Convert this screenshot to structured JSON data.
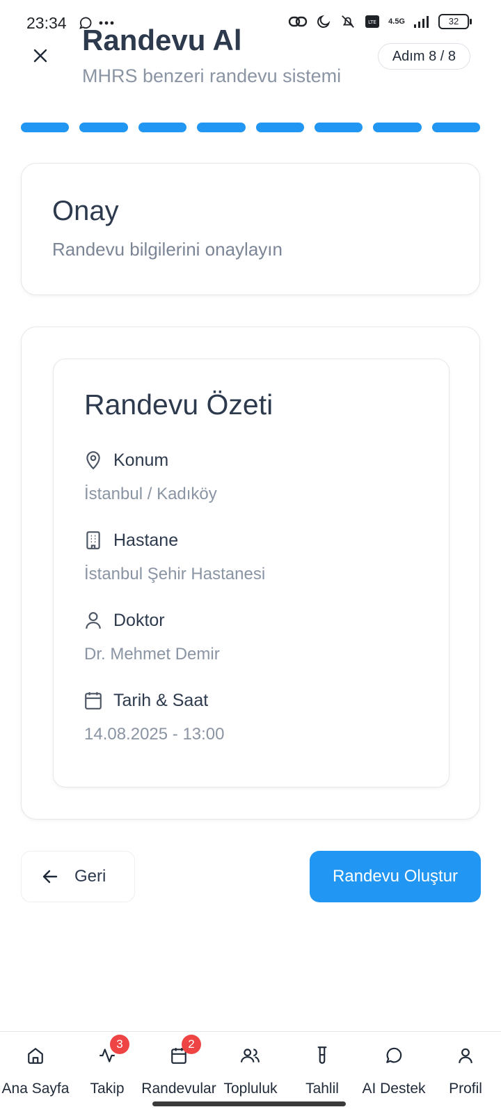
{
  "status_bar": {
    "time": "23:34",
    "network": "4.5G",
    "battery": "32"
  },
  "header": {
    "title": "Randevu Al",
    "subtitle": "MHRS benzeri randevu sistemi",
    "step_badge": "Adım 8 / 8"
  },
  "progress": {
    "total_steps": 8,
    "completed_steps": 8,
    "color": "#2196f3"
  },
  "step_card": {
    "title": "Onay",
    "subtitle": "Randevu bilgilerini onaylayın"
  },
  "summary": {
    "title": "Randevu Özeti",
    "items": [
      {
        "icon": "map-pin-icon",
        "label": "Konum",
        "value": "İstanbul / Kadıköy"
      },
      {
        "icon": "building-icon",
        "label": "Hastane",
        "value": "İstanbul Şehir Hastanesi"
      },
      {
        "icon": "user-icon",
        "label": "Doktor",
        "value": "Dr. Mehmet Demir"
      },
      {
        "icon": "calendar-icon",
        "label": "Tarih & Saat",
        "value": "14.08.2025 - 13:00"
      }
    ]
  },
  "actions": {
    "back_label": "Geri",
    "submit_label": "Randevu Oluştur"
  },
  "bottom_nav": {
    "items": [
      {
        "label": "Ana Sayfa",
        "icon": "home-icon"
      },
      {
        "label": "Takip",
        "icon": "activity-icon",
        "badge": "3"
      },
      {
        "label": "Randevular",
        "icon": "calendar-icon",
        "badge": "2"
      },
      {
        "label": "Topluluk",
        "icon": "users-icon"
      },
      {
        "label": "Tahlil",
        "icon": "test-tube-icon"
      },
      {
        "label": "AI Destek",
        "icon": "chat-bubble-icon"
      },
      {
        "label": "Profil",
        "icon": "user-icon"
      }
    ]
  },
  "colors": {
    "accent": "#2196f3",
    "badge": "#ef4444",
    "text": "#2d3a4d",
    "muted": "#8a94a3"
  }
}
